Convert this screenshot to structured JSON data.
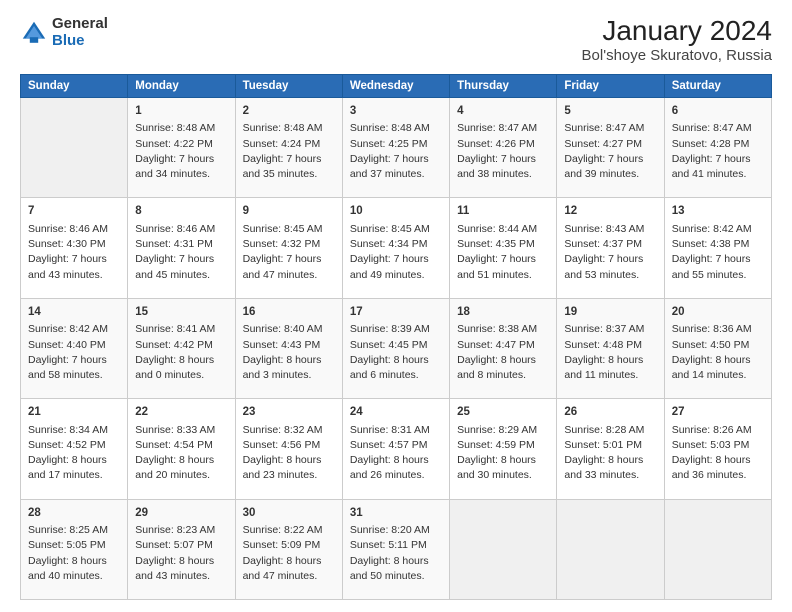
{
  "header": {
    "logo_general": "General",
    "logo_blue": "Blue",
    "title": "January 2024",
    "subtitle": "Bol'shoye Skuratovo, Russia"
  },
  "days_of_week": [
    "Sunday",
    "Monday",
    "Tuesday",
    "Wednesday",
    "Thursday",
    "Friday",
    "Saturday"
  ],
  "weeks": [
    [
      {
        "day": "",
        "info": ""
      },
      {
        "day": "1",
        "info": "Sunrise: 8:48 AM\nSunset: 4:22 PM\nDaylight: 7 hours\nand 34 minutes."
      },
      {
        "day": "2",
        "info": "Sunrise: 8:48 AM\nSunset: 4:24 PM\nDaylight: 7 hours\nand 35 minutes."
      },
      {
        "day": "3",
        "info": "Sunrise: 8:48 AM\nSunset: 4:25 PM\nDaylight: 7 hours\nand 37 minutes."
      },
      {
        "day": "4",
        "info": "Sunrise: 8:47 AM\nSunset: 4:26 PM\nDaylight: 7 hours\nand 38 minutes."
      },
      {
        "day": "5",
        "info": "Sunrise: 8:47 AM\nSunset: 4:27 PM\nDaylight: 7 hours\nand 39 minutes."
      },
      {
        "day": "6",
        "info": "Sunrise: 8:47 AM\nSunset: 4:28 PM\nDaylight: 7 hours\nand 41 minutes."
      }
    ],
    [
      {
        "day": "7",
        "info": "Sunrise: 8:46 AM\nSunset: 4:30 PM\nDaylight: 7 hours\nand 43 minutes."
      },
      {
        "day": "8",
        "info": "Sunrise: 8:46 AM\nSunset: 4:31 PM\nDaylight: 7 hours\nand 45 minutes."
      },
      {
        "day": "9",
        "info": "Sunrise: 8:45 AM\nSunset: 4:32 PM\nDaylight: 7 hours\nand 47 minutes."
      },
      {
        "day": "10",
        "info": "Sunrise: 8:45 AM\nSunset: 4:34 PM\nDaylight: 7 hours\nand 49 minutes."
      },
      {
        "day": "11",
        "info": "Sunrise: 8:44 AM\nSunset: 4:35 PM\nDaylight: 7 hours\nand 51 minutes."
      },
      {
        "day": "12",
        "info": "Sunrise: 8:43 AM\nSunset: 4:37 PM\nDaylight: 7 hours\nand 53 minutes."
      },
      {
        "day": "13",
        "info": "Sunrise: 8:42 AM\nSunset: 4:38 PM\nDaylight: 7 hours\nand 55 minutes."
      }
    ],
    [
      {
        "day": "14",
        "info": "Sunrise: 8:42 AM\nSunset: 4:40 PM\nDaylight: 7 hours\nand 58 minutes."
      },
      {
        "day": "15",
        "info": "Sunrise: 8:41 AM\nSunset: 4:42 PM\nDaylight: 8 hours\nand 0 minutes."
      },
      {
        "day": "16",
        "info": "Sunrise: 8:40 AM\nSunset: 4:43 PM\nDaylight: 8 hours\nand 3 minutes."
      },
      {
        "day": "17",
        "info": "Sunrise: 8:39 AM\nSunset: 4:45 PM\nDaylight: 8 hours\nand 6 minutes."
      },
      {
        "day": "18",
        "info": "Sunrise: 8:38 AM\nSunset: 4:47 PM\nDaylight: 8 hours\nand 8 minutes."
      },
      {
        "day": "19",
        "info": "Sunrise: 8:37 AM\nSunset: 4:48 PM\nDaylight: 8 hours\nand 11 minutes."
      },
      {
        "day": "20",
        "info": "Sunrise: 8:36 AM\nSunset: 4:50 PM\nDaylight: 8 hours\nand 14 minutes."
      }
    ],
    [
      {
        "day": "21",
        "info": "Sunrise: 8:34 AM\nSunset: 4:52 PM\nDaylight: 8 hours\nand 17 minutes."
      },
      {
        "day": "22",
        "info": "Sunrise: 8:33 AM\nSunset: 4:54 PM\nDaylight: 8 hours\nand 20 minutes."
      },
      {
        "day": "23",
        "info": "Sunrise: 8:32 AM\nSunset: 4:56 PM\nDaylight: 8 hours\nand 23 minutes."
      },
      {
        "day": "24",
        "info": "Sunrise: 8:31 AM\nSunset: 4:57 PM\nDaylight: 8 hours\nand 26 minutes."
      },
      {
        "day": "25",
        "info": "Sunrise: 8:29 AM\nSunset: 4:59 PM\nDaylight: 8 hours\nand 30 minutes."
      },
      {
        "day": "26",
        "info": "Sunrise: 8:28 AM\nSunset: 5:01 PM\nDaylight: 8 hours\nand 33 minutes."
      },
      {
        "day": "27",
        "info": "Sunrise: 8:26 AM\nSunset: 5:03 PM\nDaylight: 8 hours\nand 36 minutes."
      }
    ],
    [
      {
        "day": "28",
        "info": "Sunrise: 8:25 AM\nSunset: 5:05 PM\nDaylight: 8 hours\nand 40 minutes."
      },
      {
        "day": "29",
        "info": "Sunrise: 8:23 AM\nSunset: 5:07 PM\nDaylight: 8 hours\nand 43 minutes."
      },
      {
        "day": "30",
        "info": "Sunrise: 8:22 AM\nSunset: 5:09 PM\nDaylight: 8 hours\nand 47 minutes."
      },
      {
        "day": "31",
        "info": "Sunrise: 8:20 AM\nSunset: 5:11 PM\nDaylight: 8 hours\nand 50 minutes."
      },
      {
        "day": "",
        "info": ""
      },
      {
        "day": "",
        "info": ""
      },
      {
        "day": "",
        "info": ""
      }
    ]
  ]
}
